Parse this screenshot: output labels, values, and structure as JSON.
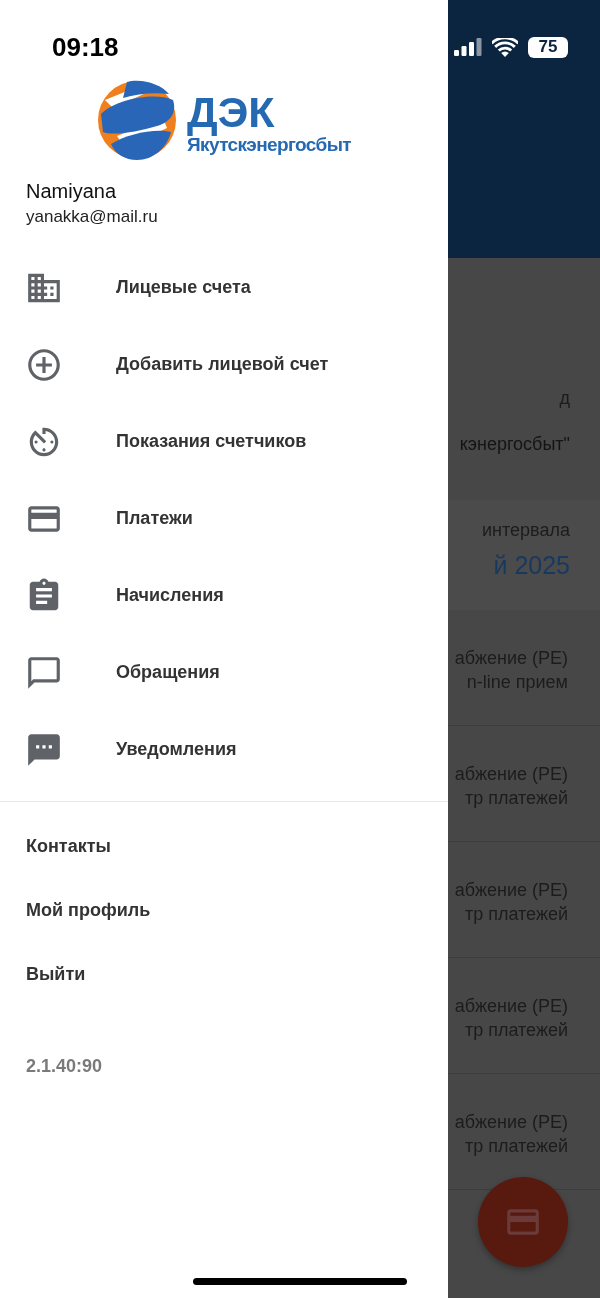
{
  "status_bar": {
    "time": "09:18",
    "battery": "75"
  },
  "logo": {
    "title": "ДЭК",
    "subtitle": "Якутскэнергосбыт"
  },
  "user": {
    "name": "Namiyana",
    "email": "yanakka@mail.ru"
  },
  "menu": [
    {
      "label": "Лицевые счета"
    },
    {
      "label": "Добавить лицевой счет"
    },
    {
      "label": "Показания счетчиков"
    },
    {
      "label": "Платежи"
    },
    {
      "label": "Начисления"
    },
    {
      "label": "Обращения"
    },
    {
      "label": "Уведомления"
    }
  ],
  "links": [
    "Контакты",
    "Мой профиль",
    "Выйти"
  ],
  "version": "2.1.40:90",
  "background": {
    "account_lines": [
      "д",
      "кэнергосбыт\""
    ],
    "interval_label": "интервала",
    "interval_value": "й 2025",
    "rows": [
      {
        "line_1": "абжение (PE)",
        "line_2": "n-line прием"
      },
      {
        "line_1": "абжение (PE)",
        "line_2": "тр платежей"
      },
      {
        "line_1": "абжение (PE)",
        "line_2": "тр платежей"
      },
      {
        "line_1": "абжение (PE)",
        "line_2": "тр платежей"
      },
      {
        "line_1": "абжение (PE)",
        "line_2": "тр платежей"
      }
    ]
  }
}
